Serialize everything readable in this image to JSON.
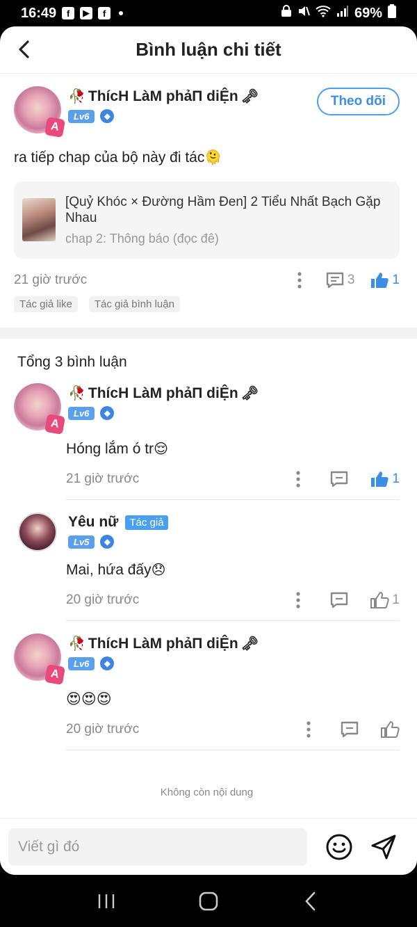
{
  "status_bar": {
    "time": "16:49",
    "battery": "69%"
  },
  "header": {
    "title": "Bình luận chi tiết"
  },
  "post": {
    "author": {
      "name": "ThícH LàM phảП diỆn",
      "level": "Lv6"
    },
    "follow_label": "Theo dõi",
    "text": "ra tiếp chap của bộ này đi tác",
    "chapter": {
      "title": "[Quỷ Khóc × Đường Hầm Đen] 2 Tiểu Nhất Bạch Gặp Nhau",
      "subtitle": "chap 2: Thông báo (đọc đê)"
    },
    "time": "21 giờ trước",
    "comment_count": "3",
    "like_count": "1",
    "tags": [
      "Tác giả like",
      "Tác giả bình luận"
    ]
  },
  "comments_section": {
    "total_label": "Tổng 3 bình luận",
    "items": [
      {
        "author": "ThícH LàM phảП diỆn",
        "level": "Lv6",
        "text": "Hóng lắm ó tr",
        "time": "21 giờ trước",
        "likes": "1",
        "liked": true
      },
      {
        "author": "Yêu nữ",
        "author_tag": "Tác giả",
        "level": "Lv5",
        "text": "Mai, hứa đấy",
        "time": "20 giờ trước",
        "likes": "1",
        "liked": false
      },
      {
        "author": "ThícH LàM phảП diỆn",
        "level": "Lv6",
        "text": "😍😍😍",
        "time": "20 giờ trước",
        "likes": "",
        "liked": false
      }
    ],
    "no_more_label": "Không còn nội dung"
  },
  "input": {
    "placeholder": "Viết gì đó"
  },
  "colors": {
    "accent": "#3a8ee6",
    "level_badge": "#5aa0ec"
  }
}
